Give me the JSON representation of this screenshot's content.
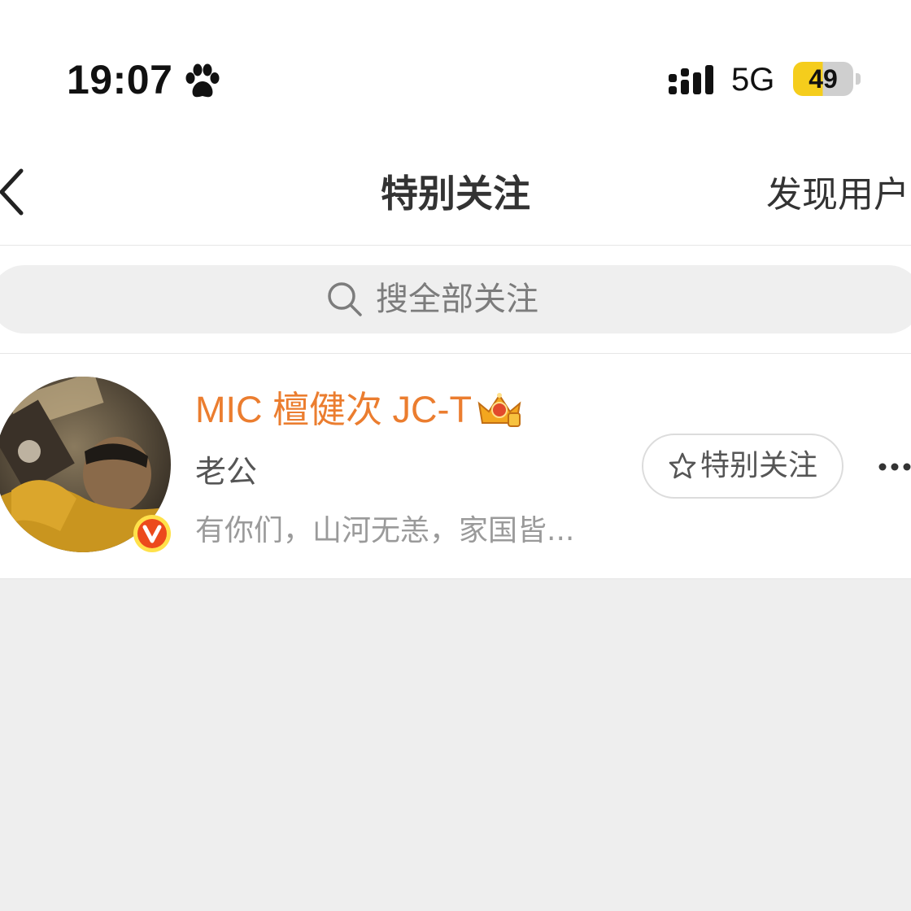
{
  "status_bar": {
    "time": "19:07",
    "network": "5G",
    "battery_level": "49",
    "icons": [
      "paw-icon",
      "signal-icon"
    ]
  },
  "nav": {
    "title": "特别关注",
    "right_action": "发现用户",
    "back_icon": "chevron-left-icon"
  },
  "search": {
    "placeholder": "搜全部关注",
    "icon": "search-icon"
  },
  "users": [
    {
      "name": "MIC 檀健次 JC-T",
      "remark": "老公",
      "description": "有你们，山河无恙，家国皆...",
      "follow_button": "特别关注",
      "badges": [
        "verified-v-icon",
        "crown-icon"
      ]
    }
  ],
  "colors": {
    "name_orange": "#eb7d2f",
    "battery_yellow": "#f5cd1c",
    "page_background": "#eeeeee"
  }
}
